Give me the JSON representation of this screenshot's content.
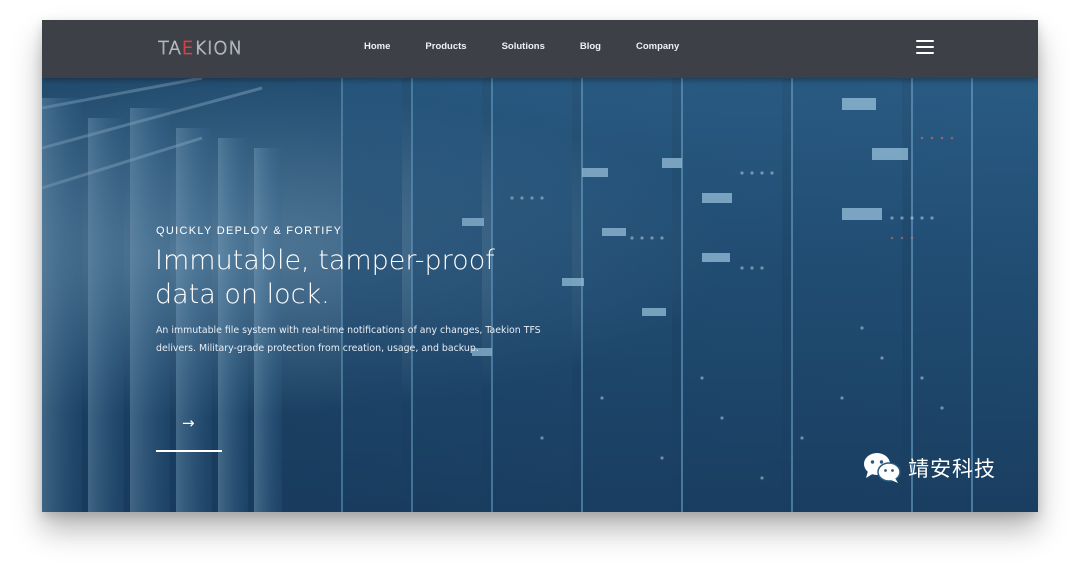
{
  "header": {
    "logo_text": "TAEKION",
    "nav": [
      {
        "label": "Home"
      },
      {
        "label": "Products"
      },
      {
        "label": "Solutions"
      },
      {
        "label": "Blog"
      },
      {
        "label": "Company"
      }
    ],
    "menu_icon": "hamburger-menu-icon"
  },
  "hero": {
    "eyebrow": "QUICKLY DEPLOY & FORTIFY",
    "headline_line1": "Immutable, tamper-proof",
    "headline_line2": "data on lock.",
    "description": "An immutable file system with real-time notifications of any changes, Taekion TFS delivers. Military-grade protection from creation, usage, and backup.",
    "cta_icon": "arrow-right-icon",
    "cta_arrow": "→"
  },
  "watermark": {
    "icon": "wechat-icon",
    "text": "靖安科技"
  },
  "colors": {
    "navbar": "#3d4047",
    "logo_accent": "#e04040",
    "text": "#ffffff"
  }
}
